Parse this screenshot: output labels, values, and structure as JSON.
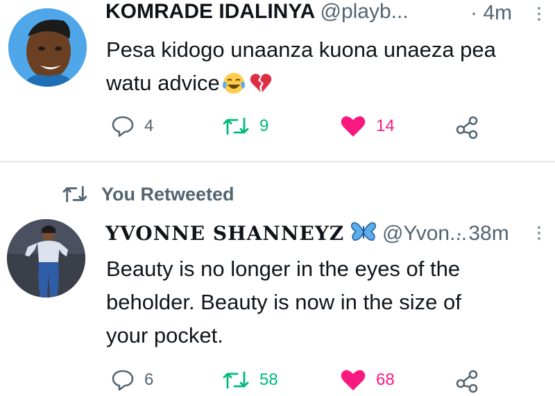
{
  "tweets": [
    {
      "display_name": "KOMRADE IDALINYA",
      "handle": "@playb...",
      "time": "· 4m",
      "text_line1": "Pesa kidogo unaanza kuona unaeza pea",
      "text_line2": "watu advice",
      "emojis": [
        "face-with-tears-of-joy",
        "broken-heart"
      ],
      "replies": "4",
      "retweets": "9",
      "likes": "14"
    },
    {
      "context": "You Retweeted",
      "display_name": "YVONNE SHANNEYZ",
      "handle": "@Yvon...",
      "time": "· 38m",
      "text_line1": "Beauty is no longer in the eyes of the",
      "text_line2": "beholder. Beauty is now in the size of",
      "text_line3": "your pocket.",
      "replies": "6",
      "retweets": "58",
      "likes": "68"
    }
  ],
  "colors": {
    "retweet": "#00ba7c",
    "like": "#f91880",
    "muted": "#536471",
    "divider": "#e4e8eb"
  },
  "icons": [
    "reply-icon",
    "retweet-icon",
    "like-icon",
    "share-icon",
    "more-icon",
    "butterfly-icon"
  ]
}
